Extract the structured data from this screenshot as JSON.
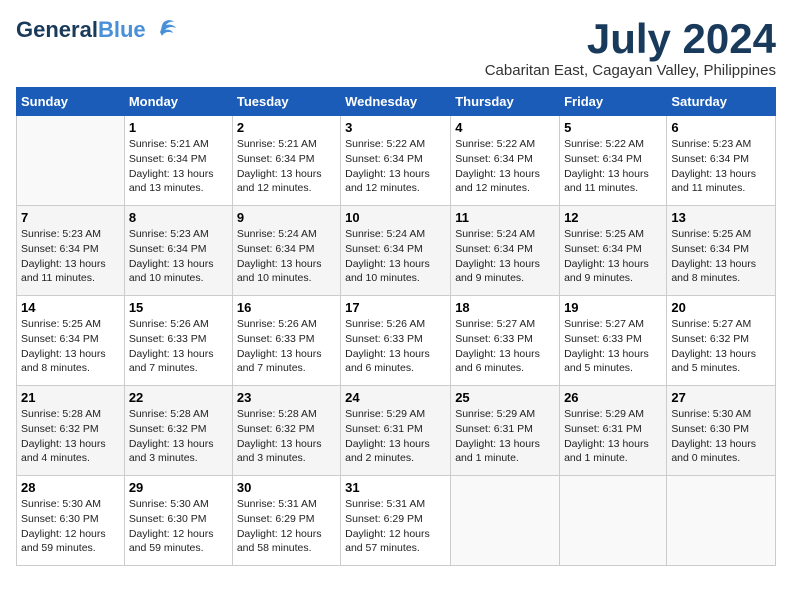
{
  "header": {
    "logo_general": "General",
    "logo_blue": "Blue",
    "month_title": "July 2024",
    "location": "Cabaritan East, Cagayan Valley, Philippines"
  },
  "weekdays": [
    "Sunday",
    "Monday",
    "Tuesday",
    "Wednesday",
    "Thursday",
    "Friday",
    "Saturday"
  ],
  "weeks": [
    [
      {
        "day": "",
        "info": ""
      },
      {
        "day": "1",
        "info": "Sunrise: 5:21 AM\nSunset: 6:34 PM\nDaylight: 13 hours\nand 13 minutes."
      },
      {
        "day": "2",
        "info": "Sunrise: 5:21 AM\nSunset: 6:34 PM\nDaylight: 13 hours\nand 12 minutes."
      },
      {
        "day": "3",
        "info": "Sunrise: 5:22 AM\nSunset: 6:34 PM\nDaylight: 13 hours\nand 12 minutes."
      },
      {
        "day": "4",
        "info": "Sunrise: 5:22 AM\nSunset: 6:34 PM\nDaylight: 13 hours\nand 12 minutes."
      },
      {
        "day": "5",
        "info": "Sunrise: 5:22 AM\nSunset: 6:34 PM\nDaylight: 13 hours\nand 11 minutes."
      },
      {
        "day": "6",
        "info": "Sunrise: 5:23 AM\nSunset: 6:34 PM\nDaylight: 13 hours\nand 11 minutes."
      }
    ],
    [
      {
        "day": "7",
        "info": "Sunrise: 5:23 AM\nSunset: 6:34 PM\nDaylight: 13 hours\nand 11 minutes."
      },
      {
        "day": "8",
        "info": "Sunrise: 5:23 AM\nSunset: 6:34 PM\nDaylight: 13 hours\nand 10 minutes."
      },
      {
        "day": "9",
        "info": "Sunrise: 5:24 AM\nSunset: 6:34 PM\nDaylight: 13 hours\nand 10 minutes."
      },
      {
        "day": "10",
        "info": "Sunrise: 5:24 AM\nSunset: 6:34 PM\nDaylight: 13 hours\nand 10 minutes."
      },
      {
        "day": "11",
        "info": "Sunrise: 5:24 AM\nSunset: 6:34 PM\nDaylight: 13 hours\nand 9 minutes."
      },
      {
        "day": "12",
        "info": "Sunrise: 5:25 AM\nSunset: 6:34 PM\nDaylight: 13 hours\nand 9 minutes."
      },
      {
        "day": "13",
        "info": "Sunrise: 5:25 AM\nSunset: 6:34 PM\nDaylight: 13 hours\nand 8 minutes."
      }
    ],
    [
      {
        "day": "14",
        "info": "Sunrise: 5:25 AM\nSunset: 6:34 PM\nDaylight: 13 hours\nand 8 minutes."
      },
      {
        "day": "15",
        "info": "Sunrise: 5:26 AM\nSunset: 6:33 PM\nDaylight: 13 hours\nand 7 minutes."
      },
      {
        "day": "16",
        "info": "Sunrise: 5:26 AM\nSunset: 6:33 PM\nDaylight: 13 hours\nand 7 minutes."
      },
      {
        "day": "17",
        "info": "Sunrise: 5:26 AM\nSunset: 6:33 PM\nDaylight: 13 hours\nand 6 minutes."
      },
      {
        "day": "18",
        "info": "Sunrise: 5:27 AM\nSunset: 6:33 PM\nDaylight: 13 hours\nand 6 minutes."
      },
      {
        "day": "19",
        "info": "Sunrise: 5:27 AM\nSunset: 6:33 PM\nDaylight: 13 hours\nand 5 minutes."
      },
      {
        "day": "20",
        "info": "Sunrise: 5:27 AM\nSunset: 6:32 PM\nDaylight: 13 hours\nand 5 minutes."
      }
    ],
    [
      {
        "day": "21",
        "info": "Sunrise: 5:28 AM\nSunset: 6:32 PM\nDaylight: 13 hours\nand 4 minutes."
      },
      {
        "day": "22",
        "info": "Sunrise: 5:28 AM\nSunset: 6:32 PM\nDaylight: 13 hours\nand 3 minutes."
      },
      {
        "day": "23",
        "info": "Sunrise: 5:28 AM\nSunset: 6:32 PM\nDaylight: 13 hours\nand 3 minutes."
      },
      {
        "day": "24",
        "info": "Sunrise: 5:29 AM\nSunset: 6:31 PM\nDaylight: 13 hours\nand 2 minutes."
      },
      {
        "day": "25",
        "info": "Sunrise: 5:29 AM\nSunset: 6:31 PM\nDaylight: 13 hours\nand 1 minute."
      },
      {
        "day": "26",
        "info": "Sunrise: 5:29 AM\nSunset: 6:31 PM\nDaylight: 13 hours\nand 1 minute."
      },
      {
        "day": "27",
        "info": "Sunrise: 5:30 AM\nSunset: 6:30 PM\nDaylight: 13 hours\nand 0 minutes."
      }
    ],
    [
      {
        "day": "28",
        "info": "Sunrise: 5:30 AM\nSunset: 6:30 PM\nDaylight: 12 hours\nand 59 minutes."
      },
      {
        "day": "29",
        "info": "Sunrise: 5:30 AM\nSunset: 6:30 PM\nDaylight: 12 hours\nand 59 minutes."
      },
      {
        "day": "30",
        "info": "Sunrise: 5:31 AM\nSunset: 6:29 PM\nDaylight: 12 hours\nand 58 minutes."
      },
      {
        "day": "31",
        "info": "Sunrise: 5:31 AM\nSunset: 6:29 PM\nDaylight: 12 hours\nand 57 minutes."
      },
      {
        "day": "",
        "info": ""
      },
      {
        "day": "",
        "info": ""
      },
      {
        "day": "",
        "info": ""
      }
    ]
  ]
}
